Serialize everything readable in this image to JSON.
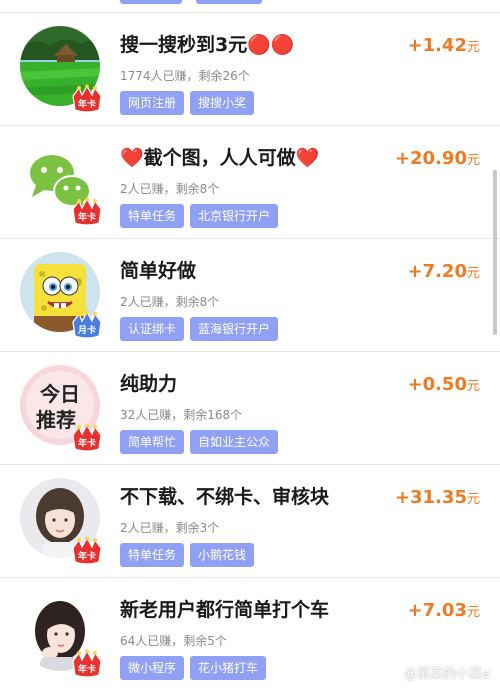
{
  "tasks": [
    {
      "title": "搜一搜秒到3元",
      "title_suffix": "🔴🔴",
      "stats": "1774人已赚，剩余26个",
      "tags": [
        "网页注册",
        "搜搜小奖"
      ],
      "reward": "+1.42",
      "unit": "元",
      "badge": "年卡",
      "avatar": "grass-field"
    },
    {
      "title_prefix": "❤️",
      "title": "截个图，人人可做",
      "title_suffix": "❤️",
      "stats": "2人已赚，剩余8个",
      "tags": [
        "特单任务",
        "北京银行开户"
      ],
      "reward": "+20.90",
      "unit": "元",
      "badge": "年卡",
      "avatar": "wechat-logo"
    },
    {
      "title": "简单好做",
      "stats": "2人已赚，剩余8个",
      "tags": [
        "认证绑卡",
        "蓝海银行开户"
      ],
      "reward": "+7.20",
      "unit": "元",
      "badge": "月卡",
      "avatar": "cartoon-sponge"
    },
    {
      "title": "纯助力",
      "stats": "32人已赚，剩余168个",
      "tags": [
        "简单帮忙",
        "自如业主公众"
      ],
      "reward": "+0.50",
      "unit": "元",
      "badge": "年卡",
      "avatar": "today-recommend",
      "avatar_text": [
        "今日",
        "推荐"
      ]
    },
    {
      "title": "不下载、不绑卡、审核块",
      "stats": "2人已赚，剩余3个",
      "tags": [
        "特单任务",
        "小鹅花钱"
      ],
      "reward": "+31.35",
      "unit": "元",
      "badge": "年卡",
      "avatar": "girl-portrait"
    },
    {
      "title": "新老用户都行简单打个车",
      "stats": "64人已赚，剩余5个",
      "tags": [
        "微小程序",
        "花小猪打车"
      ],
      "reward": "+7.03",
      "unit": "元",
      "badge": "年卡",
      "avatar": "girl-portrait-2"
    }
  ],
  "watermark": "@菜菜的小菜a",
  "colors": {
    "tag_bg": "#8fa0f5",
    "reward": "#f07a22",
    "crown": "#e8312f"
  }
}
